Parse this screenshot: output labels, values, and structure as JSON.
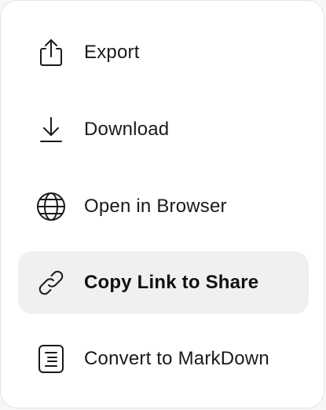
{
  "menu": {
    "items": [
      {
        "id": "export",
        "label": "Export",
        "icon": "share-export-icon",
        "active": false
      },
      {
        "id": "download",
        "label": "Download",
        "icon": "download-icon",
        "active": false
      },
      {
        "id": "open-browser",
        "label": "Open in Browser",
        "icon": "globe-icon",
        "active": false
      },
      {
        "id": "copy-link",
        "label": "Copy Link to Share",
        "icon": "link-icon",
        "active": true
      },
      {
        "id": "convert-markdown",
        "label": "Convert to MarkDown",
        "icon": "document-icon",
        "active": false
      }
    ]
  },
  "colors": {
    "background": "#ffffff",
    "highlight": "#f0f0f0",
    "text": "#1a1a1a",
    "border": "#e5e5e5"
  }
}
